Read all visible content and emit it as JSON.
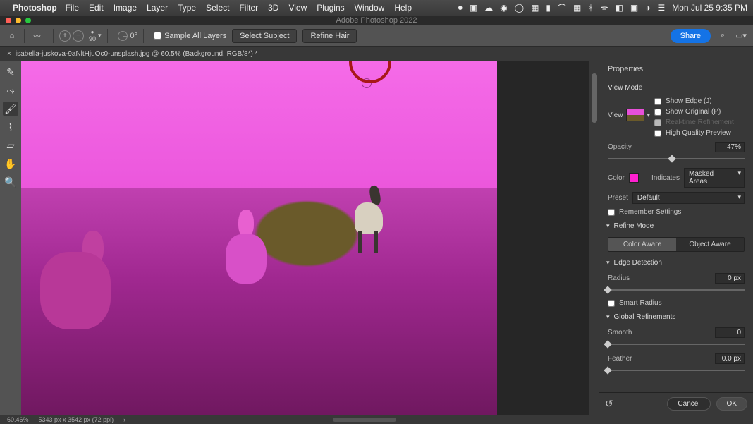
{
  "mac_menu": {
    "app": "Photoshop",
    "items": [
      "File",
      "Edit",
      "Image",
      "Layer",
      "Type",
      "Select",
      "Filter",
      "3D",
      "View",
      "Plugins",
      "Window",
      "Help"
    ],
    "datetime": "Mon Jul 25  9:35 PM"
  },
  "titlebar": {
    "title": "Adobe Photoshop 2022"
  },
  "options": {
    "brush_size": "90",
    "angle": "0°",
    "sample_all_layers": "Sample All Layers",
    "select_subject": "Select Subject",
    "refine_hair": "Refine Hair",
    "share": "Share"
  },
  "doc_tab": {
    "name": "isabella-juskova-9aNltHjuOc0-unsplash.jpg @ 60.5% (Background, RGB/8*) *"
  },
  "panel": {
    "title": "Properties",
    "view_mode": {
      "header": "View Mode",
      "view_label": "View",
      "show_edge": "Show Edge (J)",
      "show_original": "Show Original (P)",
      "real_time": "Real-time Refinement",
      "hq_preview": "High Quality Preview"
    },
    "opacity": {
      "label": "Opacity",
      "value": "47%"
    },
    "color_label": "Color",
    "indicates_label": "Indicates",
    "indicates_value": "Masked Areas",
    "preset_label": "Preset",
    "preset_value": "Default",
    "remember": "Remember Settings",
    "refine_mode": {
      "header": "Refine Mode",
      "color_aware": "Color Aware",
      "object_aware": "Object Aware"
    },
    "edge_detection": {
      "header": "Edge Detection",
      "radius_label": "Radius",
      "radius_value": "0 px",
      "smart_radius": "Smart Radius"
    },
    "global": {
      "header": "Global Refinements",
      "smooth_label": "Smooth",
      "smooth_value": "0",
      "feather_label": "Feather",
      "feather_value": "0.0 px"
    },
    "footer": {
      "cancel": "Cancel",
      "ok": "OK"
    }
  },
  "status": {
    "zoom": "60.46%",
    "dims": "5343 px x 3542 px (72 ppi)"
  }
}
